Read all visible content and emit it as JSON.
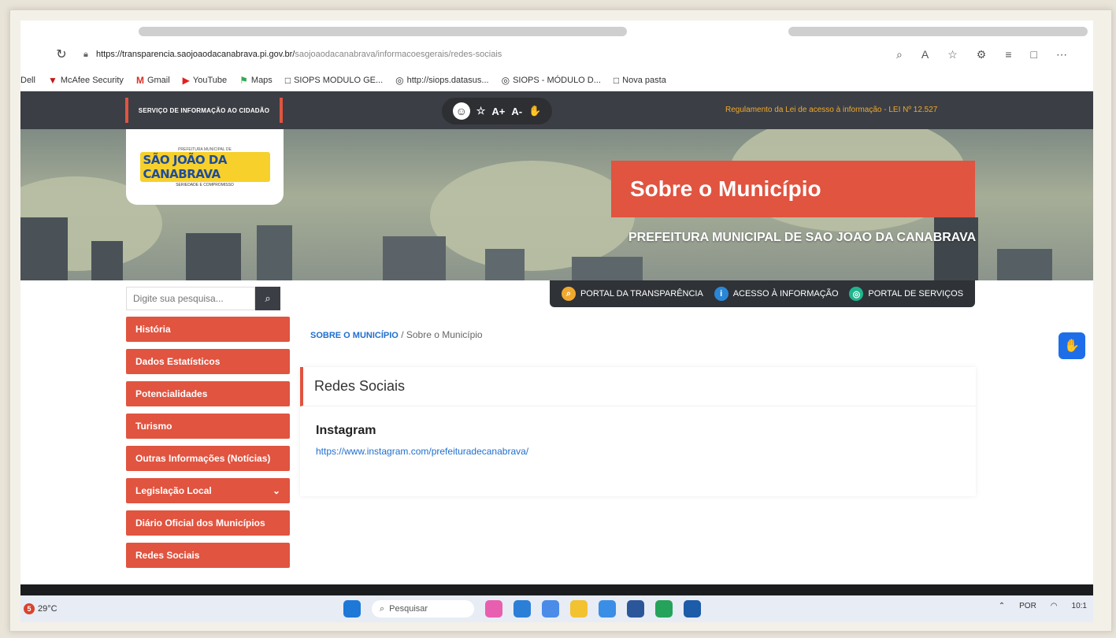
{
  "browser": {
    "url_host": "https://transparencia.saojoaodacanabrava.pi.gov.br/",
    "url_path": "saojoaodacanabrava/informacoesgerais/redes-sociais",
    "bookmarks": [
      "Dell",
      "McAfee Security",
      "Gmail",
      "YouTube",
      "Maps",
      "SIOPS MODULO GE...",
      "http://siops.datasus...",
      "SIOPS - MÓDULO D...",
      "Nova pasta"
    ]
  },
  "topbar": {
    "sic_label": "SERVIÇO DE INFORMAÇÃO AO CIDADÃO",
    "font_plus": "A+",
    "font_minus": "A-",
    "lei_text": "Regulamento da Lei de acesso à informação - LEI Nº 12.527"
  },
  "hero": {
    "logo_text": "SÃO JOÃO DA CANABRAVA",
    "logo_top": "PREFEITURA MUNICIPAL DE",
    "logo_sub": "SERIEDADE E COMPROMISSO",
    "title": "Sobre o Município",
    "subtitle": "PREFEITURA MUNICIPAL DE SAO JOAO DA CANABRAVA"
  },
  "portals": [
    {
      "label": "PORTAL DA TRANSPARÊNCIA",
      "color": "#f0a92e"
    },
    {
      "label": "ACESSO À INFORMAÇÃO",
      "color": "#2a87d8"
    },
    {
      "label": "PORTAL DE SERVIÇOS",
      "color": "#20b58e"
    }
  ],
  "search": {
    "placeholder": "Digite sua pesquisa..."
  },
  "menu": [
    {
      "label": "História"
    },
    {
      "label": "Dados Estatísticos"
    },
    {
      "label": "Potencialidades"
    },
    {
      "label": "Turismo"
    },
    {
      "label": "Outras Informações (Notícias)"
    },
    {
      "label": "Legislação Local",
      "has_dropdown": true
    },
    {
      "label": "Diário Oficial dos Municípios"
    },
    {
      "label": "Redes Sociais"
    }
  ],
  "breadcrumb": {
    "section": "SOBRE O MUNICÍPIO",
    "separator": "/",
    "current": "Sobre o Município"
  },
  "content": {
    "panel_title": "Redes Sociais",
    "section_title": "Instagram",
    "link": "https://www.instagram.com/prefeituradecanabrava/"
  },
  "taskbar": {
    "temperature": "29°C",
    "weather_badge": "5",
    "search_placeholder": "Pesquisar",
    "lang": "POR",
    "time": "10:1"
  },
  "colors": {
    "accent": "#e05440",
    "dark": "#3b3e44",
    "link": "#1f6fcf"
  }
}
